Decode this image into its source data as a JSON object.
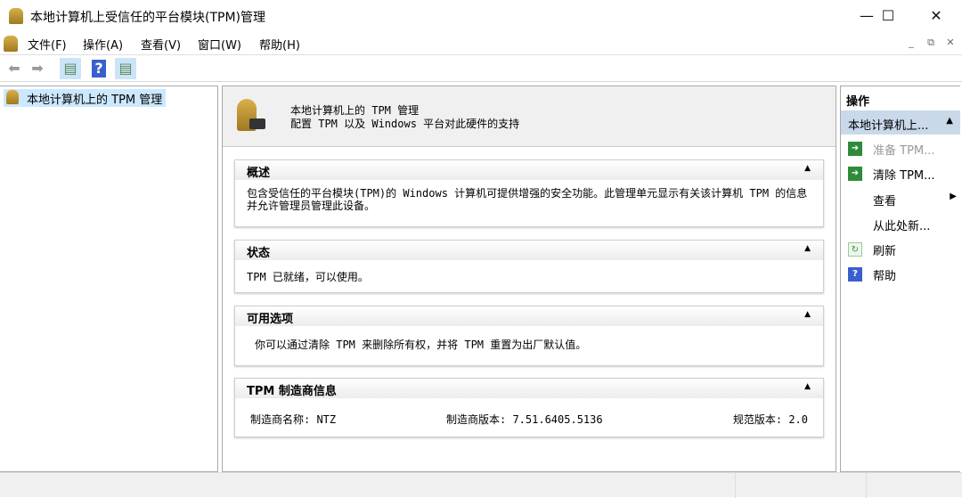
{
  "window": {
    "title": "本地计算机上受信任的平台模块(TPM)管理",
    "minimize": "—",
    "maximize": "☐",
    "close": "✕"
  },
  "menu": [
    "文件(F)",
    "操作(A)",
    "查看(V)",
    "窗口(W)",
    "帮助(H)"
  ],
  "mdi": [
    "_",
    "⧉",
    "✕"
  ],
  "tree": {
    "root": "本地计算机上的 TPM 管理"
  },
  "header": {
    "title": "本地计算机上的 TPM 管理",
    "subtitle": "配置 TPM 以及 Windows 平台对此硬件的支持"
  },
  "sections": [
    {
      "title": "概述",
      "body": "包含受信任的平台模块(TPM)的 Windows 计算机可提供增强的安全功能。此管理单元显示有关该计算机 TPM 的信息并允许管理员管理此设备。"
    },
    {
      "title": "状态",
      "body": "TPM 已就绪，可以使用。"
    },
    {
      "title": "可用选项",
      "body": "你可以通过清除 TPM 来删除所有权，并将 TPM 重置为出厂默认值。"
    },
    {
      "title": "TPM 制造商信息",
      "manufacturer_name": "制造商名称: NTZ",
      "manufacturer_version": "制造商版本: 7.51.6405.5136",
      "spec_version": "规范版本: 2.0"
    }
  ],
  "actions": {
    "header": "操作",
    "selected": "本地计算机上...",
    "items": [
      {
        "label": "准备 TPM...",
        "icon": "green-arrow-icon",
        "disabled": true
      },
      {
        "label": "清除 TPM...",
        "icon": "green-arrow-icon"
      },
      {
        "label": "查看",
        "icon": "none",
        "submenu": true
      },
      {
        "label": "从此处新...",
        "icon": "none"
      },
      {
        "label": "刷新",
        "icon": "refresh-icon"
      },
      {
        "label": "帮助",
        "icon": "help-icon"
      }
    ]
  },
  "colors": {
    "selection": "#cce8ff",
    "action_selected": "#c9d9ea",
    "green": "#2e8b3a",
    "help_blue": "#3a5fcd"
  }
}
